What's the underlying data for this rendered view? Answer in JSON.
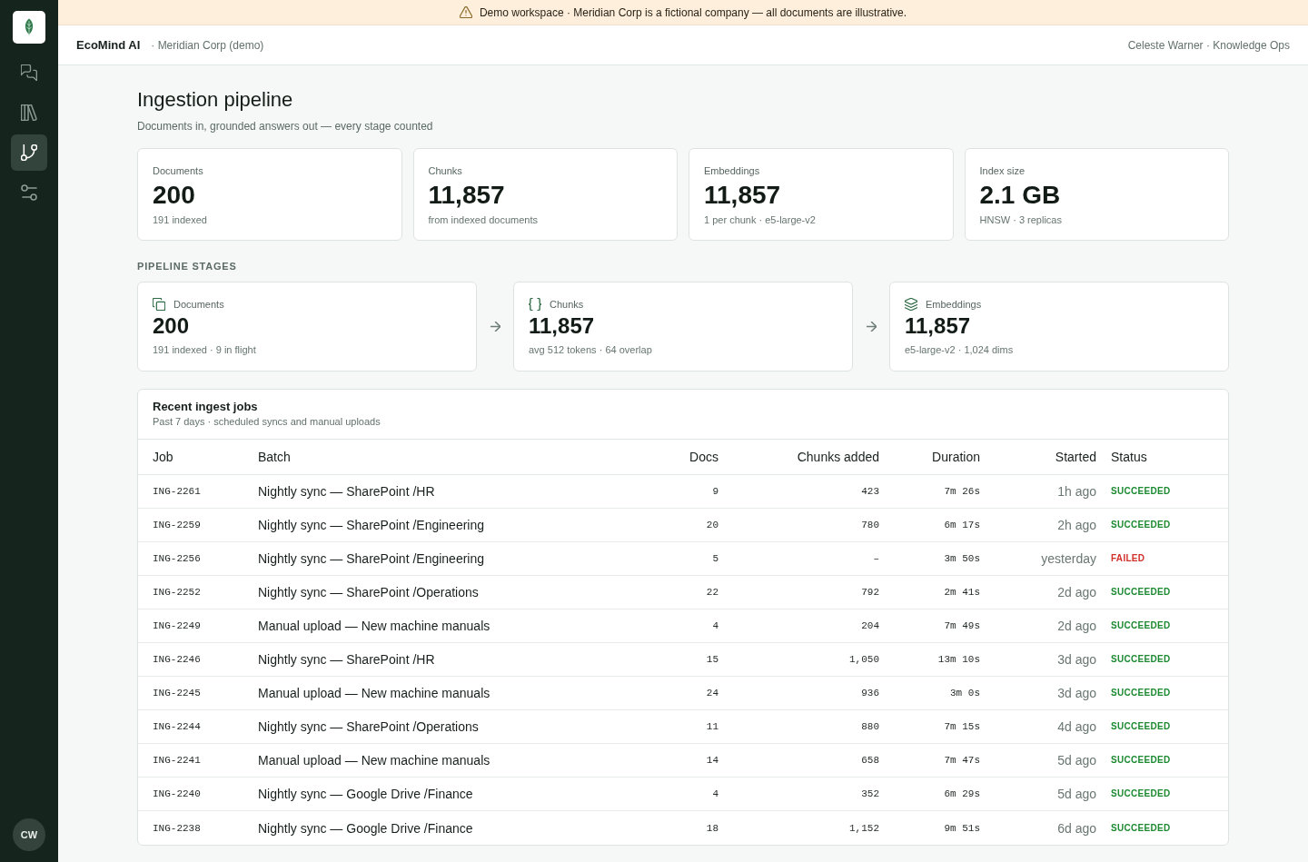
{
  "sidebar": {
    "nav": [
      {
        "selected": false
      },
      {
        "selected": false
      },
      {
        "selected": true
      },
      {
        "selected": false
      }
    ],
    "avatar": "CW"
  },
  "banner": {
    "text": "Demo workspace · Meridian Corp is a fictional company — all documents are illustrative."
  },
  "header": {
    "brand": "EcoMind AI",
    "workspace": "· Meridian Corp (demo)",
    "user": "Celeste Warner · Knowledge Ops"
  },
  "page": {
    "title": "Ingestion pipeline",
    "subtitle": "Documents in, grounded answers out — every stage counted"
  },
  "stats": [
    {
      "label": "Documents",
      "value": "200",
      "note": "191 indexed"
    },
    {
      "label": "Chunks",
      "value": "11,857",
      "note": "from indexed documents"
    },
    {
      "label": "Embeddings",
      "value": "11,857",
      "note": "1 per chunk · e5-large-v2"
    },
    {
      "label": "Index size",
      "value": "2.1 GB",
      "note": "HNSW · 3 replicas"
    }
  ],
  "stages_heading": "PIPELINE STAGES",
  "stages": [
    {
      "label": "Documents",
      "value": "200",
      "note": "191 indexed · 9 in flight"
    },
    {
      "label": "Chunks",
      "value": "11,857",
      "note": "avg 512 tokens · 64 overlap"
    },
    {
      "label": "Embeddings",
      "value": "11,857",
      "note": "e5-large-v2 · 1,024 dims"
    }
  ],
  "jobs": {
    "title": "Recent ingest jobs",
    "subtitle": "Past 7 days · scheduled syncs and manual uploads",
    "columns": [
      "Job",
      "Batch",
      "Docs",
      "Chunks added",
      "Duration",
      "Started",
      "Status"
    ],
    "rows": [
      {
        "job": "ING-2261",
        "batch": "Nightly sync — SharePoint /HR",
        "docs": "9",
        "chunks": "423",
        "duration": "7m 26s",
        "started": "1h ago",
        "status": {
          "label": "SUCCEEDED",
          "kind": "success"
        }
      },
      {
        "job": "ING-2259",
        "batch": "Nightly sync — SharePoint /Engineering",
        "docs": "20",
        "chunks": "780",
        "duration": "6m 17s",
        "started": "2h ago",
        "status": {
          "label": "SUCCEEDED",
          "kind": "success"
        }
      },
      {
        "job": "ING-2256",
        "batch": "Nightly sync — SharePoint /Engineering",
        "docs": "5",
        "chunks": "–",
        "duration": "3m 50s",
        "started": "yesterday",
        "status": {
          "label": "FAILED",
          "kind": "failed"
        }
      },
      {
        "job": "ING-2252",
        "batch": "Nightly sync — SharePoint /Operations",
        "docs": "22",
        "chunks": "792",
        "duration": "2m 41s",
        "started": "2d ago",
        "status": {
          "label": "SUCCEEDED",
          "kind": "success"
        }
      },
      {
        "job": "ING-2249",
        "batch": "Manual upload — New machine manuals",
        "docs": "4",
        "chunks": "204",
        "duration": "7m 49s",
        "started": "2d ago",
        "status": {
          "label": "SUCCEEDED",
          "kind": "success"
        }
      },
      {
        "job": "ING-2246",
        "batch": "Nightly sync — SharePoint /HR",
        "docs": "15",
        "chunks": "1,050",
        "duration": "13m 10s",
        "started": "3d ago",
        "status": {
          "label": "SUCCEEDED",
          "kind": "success"
        }
      },
      {
        "job": "ING-2245",
        "batch": "Manual upload — New machine manuals",
        "docs": "24",
        "chunks": "936",
        "duration": "3m 0s",
        "started": "3d ago",
        "status": {
          "label": "SUCCEEDED",
          "kind": "success"
        }
      },
      {
        "job": "ING-2244",
        "batch": "Nightly sync — SharePoint /Operations",
        "docs": "11",
        "chunks": "880",
        "duration": "7m 15s",
        "started": "4d ago",
        "status": {
          "label": "SUCCEEDED",
          "kind": "success"
        }
      },
      {
        "job": "ING-2241",
        "batch": "Manual upload — New machine manuals",
        "docs": "14",
        "chunks": "658",
        "duration": "7m 47s",
        "started": "5d ago",
        "status": {
          "label": "SUCCEEDED",
          "kind": "success"
        }
      },
      {
        "job": "ING-2240",
        "batch": "Nightly sync — Google Drive /Finance",
        "docs": "4",
        "chunks": "352",
        "duration": "6m 29s",
        "started": "5d ago",
        "status": {
          "label": "SUCCEEDED",
          "kind": "success"
        }
      },
      {
        "job": "ING-2238",
        "batch": "Nightly sync — Google Drive /Finance",
        "docs": "18",
        "chunks": "1,152",
        "duration": "9m 51s",
        "started": "6d ago",
        "status": {
          "label": "SUCCEEDED",
          "kind": "success"
        }
      }
    ]
  }
}
